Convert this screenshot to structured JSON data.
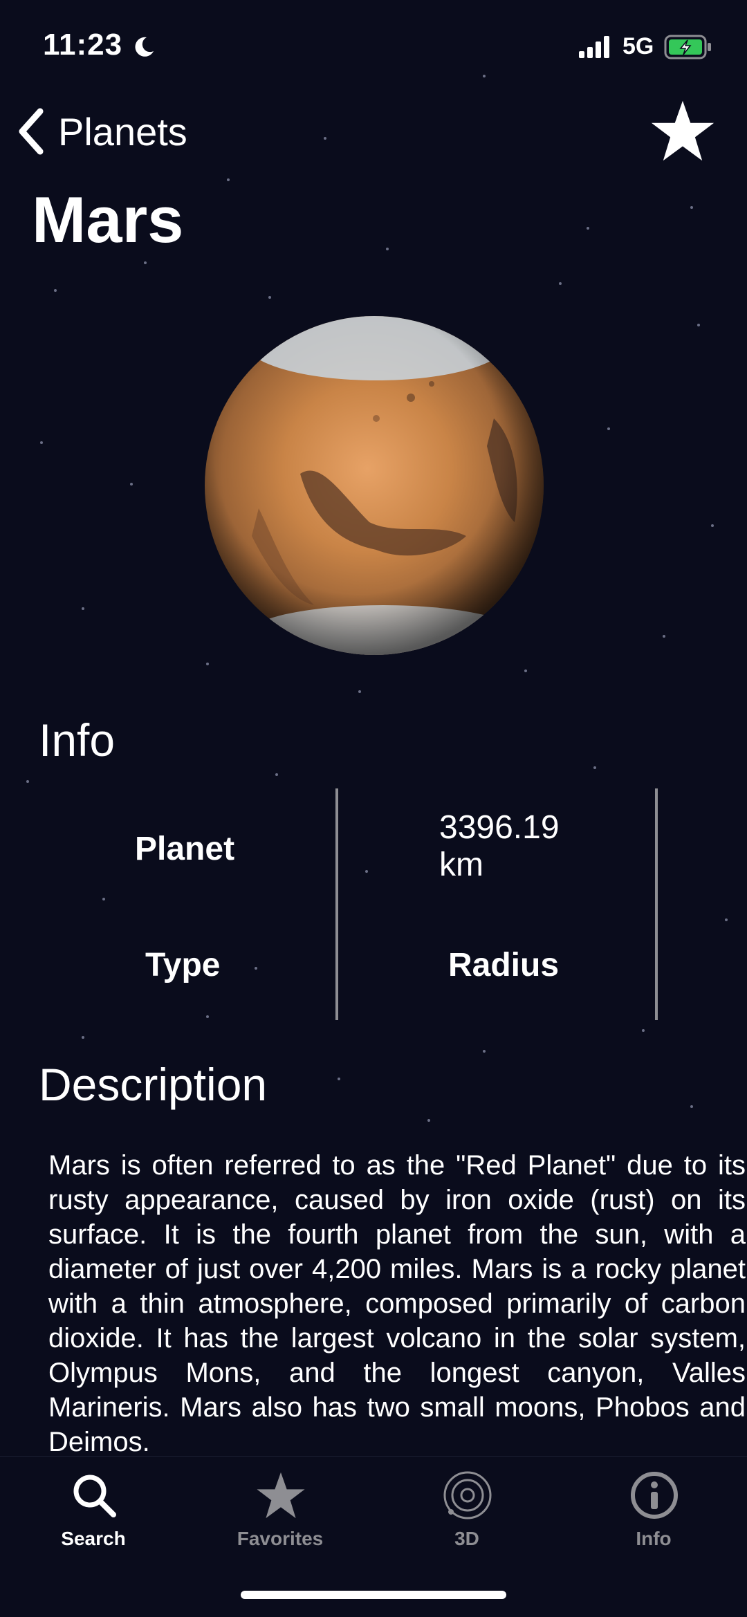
{
  "status_bar": {
    "time": "11:23",
    "network": "5G",
    "icons": [
      "moon-icon",
      "signal-icon",
      "battery-charging-icon"
    ]
  },
  "nav": {
    "back_label": "Planets",
    "back_icon": "chevron-left-icon",
    "favorite_icon": "star-icon"
  },
  "page": {
    "title": "Mars"
  },
  "info": {
    "heading": "Info",
    "planet_label": "Planet",
    "radius_value": "3396.19 km",
    "type_label": "Type",
    "radius_label": "Radius"
  },
  "description": {
    "heading": "Description",
    "text": " Mars is often referred to as the \"Red Planet\" due to its rusty appearance, caused by iron oxide (rust) on its surface. It is the fourth planet from the sun, with a diameter of just over 4,200 miles. Mars is a rocky planet with a thin atmosphere, composed primarily of carbon dioxide. It has the largest volcano in the solar system, Olympus Mons, and the longest canyon, Valles Marineris. Mars also has two small moons, Phobos and Deimos."
  },
  "tabs": [
    {
      "label": "Search",
      "icon": "search-icon",
      "active": true
    },
    {
      "label": "Favorites",
      "icon": "star-icon",
      "active": false
    },
    {
      "label": "3D",
      "icon": "orbit-icon",
      "active": false
    },
    {
      "label": "Info",
      "icon": "info-icon",
      "active": false
    }
  ],
  "colors": {
    "background": "#0a0c1c",
    "text": "#ffffff",
    "inactive_tab": "#8e8e93",
    "divider": "#8e8e93",
    "battery_charge": "#34c759"
  }
}
